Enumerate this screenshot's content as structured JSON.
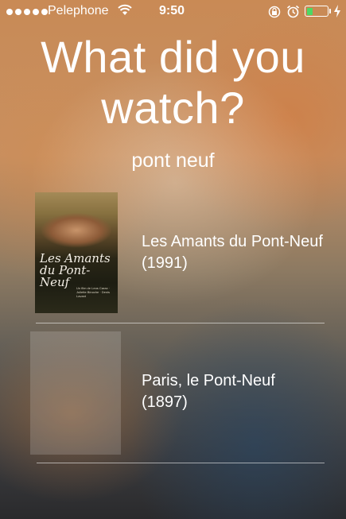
{
  "status_bar": {
    "carrier": "Pelephone",
    "time": "9:50",
    "battery_color": "#4cd964"
  },
  "screen": {
    "title": "What did you watch?",
    "query": "pont neuf"
  },
  "results": [
    {
      "title": "Les Amants du Pont-Neuf (1991)",
      "poster": {
        "title_text": "Les Amants du Pont-Neuf",
        "credits": "Un film de Leos Carax · Juliette Binoche · Denis Lavant"
      }
    },
    {
      "title": "Paris, le Pont-Neuf (1897)",
      "poster": null
    }
  ]
}
